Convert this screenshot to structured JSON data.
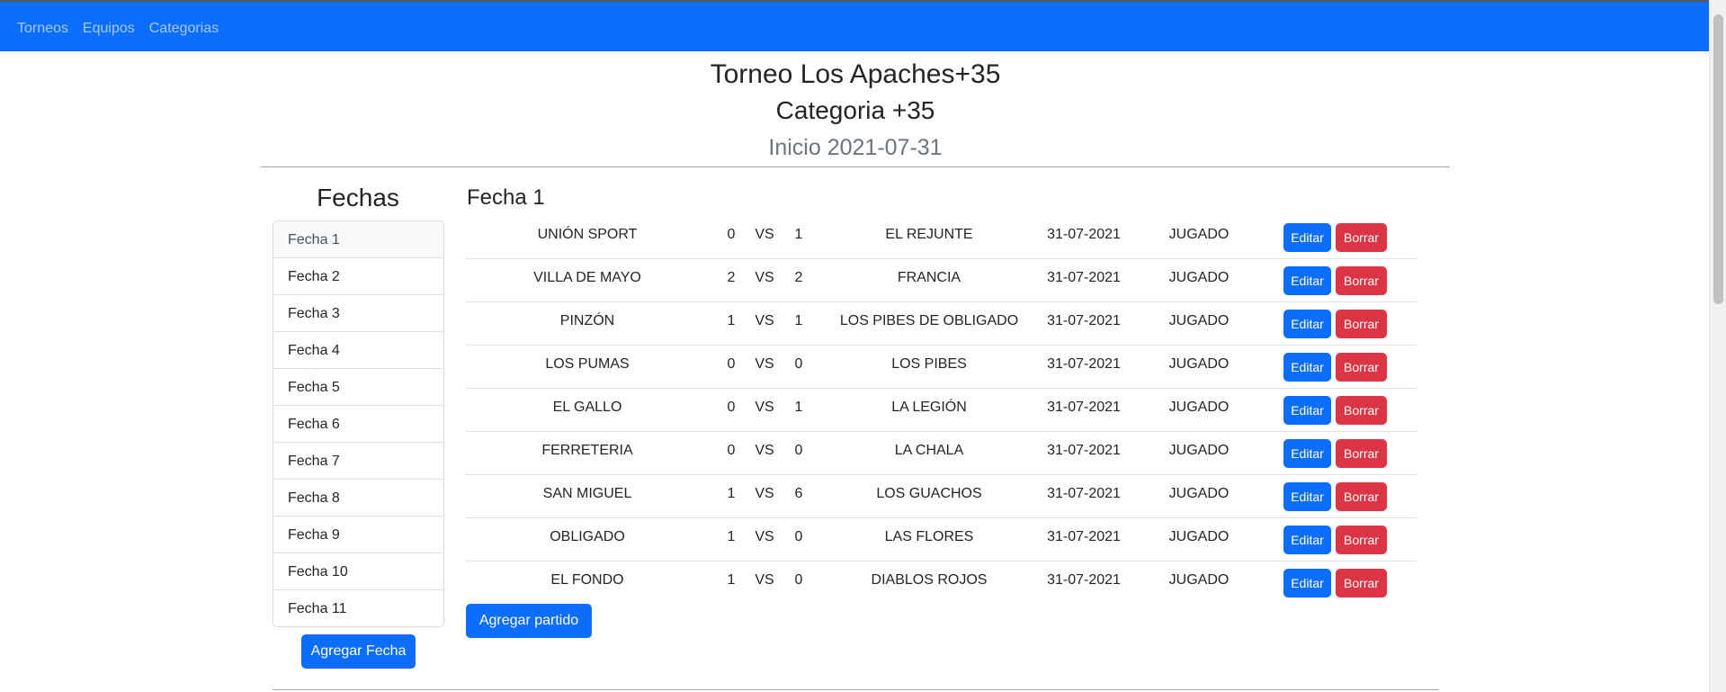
{
  "nav": {
    "items": [
      "Torneos",
      "Equipos",
      "Categorias"
    ]
  },
  "header": {
    "title": "Torneo Los Apaches+35",
    "category": "Categoria +35",
    "start": "Inicio 2021-07-31"
  },
  "sidebar": {
    "title": "Fechas",
    "items": [
      "Fecha 1",
      "Fecha 2",
      "Fecha 3",
      "Fecha 4",
      "Fecha 5",
      "Fecha 6",
      "Fecha 7",
      "Fecha 8",
      "Fecha 9",
      "Fecha 10",
      "Fecha 11"
    ],
    "active_index": 0,
    "add_button": "Agregar Fecha"
  },
  "main": {
    "title": "Fecha 1",
    "vs_label": "VS",
    "edit_label": "Editar",
    "delete_label": "Borrar",
    "add_button": "Agregar partido",
    "matches": [
      {
        "local": "UNIÓN SPORT",
        "g1": "0",
        "g2": "1",
        "visit": "EL REJUNTE",
        "date": "31-07-2021",
        "state": "JUGADO"
      },
      {
        "local": "VILLA DE MAYO",
        "g1": "2",
        "g2": "2",
        "visit": "FRANCIA",
        "date": "31-07-2021",
        "state": "JUGADO"
      },
      {
        "local": "PINZÓN",
        "g1": "1",
        "g2": "1",
        "visit": "LOS PIBES DE OBLIGADO",
        "date": "31-07-2021",
        "state": "JUGADO"
      },
      {
        "local": "LOS PUMAS",
        "g1": "0",
        "g2": "0",
        "visit": "LOS PIBES",
        "date": "31-07-2021",
        "state": "JUGADO"
      },
      {
        "local": "EL GALLO",
        "g1": "0",
        "g2": "1",
        "visit": "LA LEGIÓN",
        "date": "31-07-2021",
        "state": "JUGADO"
      },
      {
        "local": "FERRETERIA",
        "g1": "0",
        "g2": "0",
        "visit": "LA CHALA",
        "date": "31-07-2021",
        "state": "JUGADO"
      },
      {
        "local": "SAN MIGUEL",
        "g1": "1",
        "g2": "6",
        "visit": "LOS GUACHOS",
        "date": "31-07-2021",
        "state": "JUGADO"
      },
      {
        "local": "OBLIGADO",
        "g1": "1",
        "g2": "0",
        "visit": "LAS FLORES",
        "date": "31-07-2021",
        "state": "JUGADO"
      },
      {
        "local": "EL FONDO",
        "g1": "1",
        "g2": "0",
        "visit": "DIABLOS ROJOS",
        "date": "31-07-2021",
        "state": "JUGADO"
      }
    ]
  },
  "colors": {
    "primary": "#0d6efd",
    "danger": "#dc3545"
  }
}
